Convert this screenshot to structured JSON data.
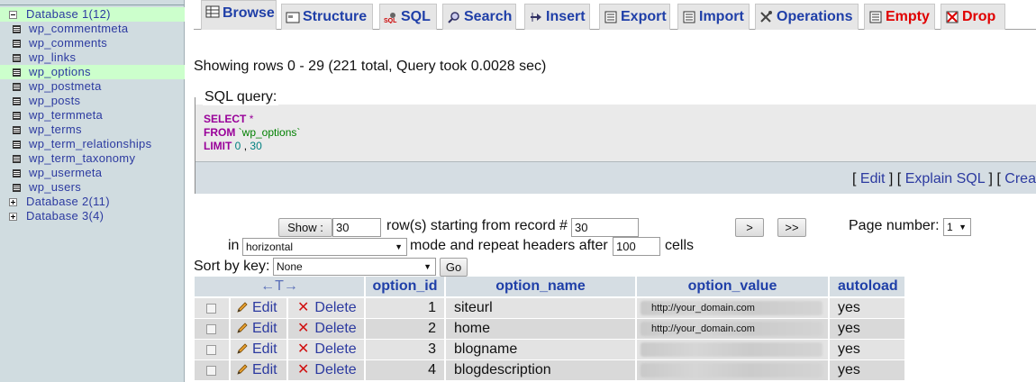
{
  "sidebar": {
    "databases": [
      {
        "label": "Database 1(12)",
        "expanded": true
      },
      {
        "label": "Database 2(11)",
        "expanded": false
      },
      {
        "label": "Database 3(4)",
        "expanded": false
      }
    ],
    "tables": [
      "wp_commentmeta",
      "wp_comments",
      "wp_links",
      "wp_options",
      "wp_postmeta",
      "wp_posts",
      "wp_termmeta",
      "wp_terms",
      "wp_term_relationships",
      "wp_term_taxonomy",
      "wp_usermeta",
      "wp_users"
    ],
    "selected_table": "wp_options"
  },
  "tabs": [
    {
      "label": "Browse",
      "icon": "browse-icon"
    },
    {
      "label": "Structure",
      "icon": "structure-icon"
    },
    {
      "label": "SQL",
      "icon": "sql-icon"
    },
    {
      "label": "Search",
      "icon": "search-icon"
    },
    {
      "label": "Insert",
      "icon": "insert-icon"
    },
    {
      "label": "Export",
      "icon": "export-icon"
    },
    {
      "label": "Import",
      "icon": "import-icon"
    },
    {
      "label": "Operations",
      "icon": "operations-icon"
    },
    {
      "label": "Empty",
      "icon": "empty-icon"
    },
    {
      "label": "Drop",
      "icon": "drop-icon"
    }
  ],
  "status": "Showing rows 0 - 29 (221 total, Query took 0.0028 sec)",
  "sql_query": {
    "legend": "SQL query:",
    "select_kw": "SELECT",
    "select_rest": "*",
    "from_kw": "FROM",
    "from_table": "`wp_options`",
    "limit_kw": "LIMIT",
    "limit_a": "0",
    "limit_sep": ",",
    "limit_b": "30",
    "links": {
      "open": "[ ",
      "edit": "Edit",
      "mid": " ] [ ",
      "explain": "Explain SQL",
      "mid2": " ] [ ",
      "create": "Crea"
    }
  },
  "navigation": {
    "show_button": "Show :",
    "rows_value": "30",
    "rows_text": "row(s) starting from record #",
    "start_value": "30",
    "next_button": ">",
    "last_button": ">>",
    "page_number_label": "Page number:",
    "page_number_value": "1",
    "in_label": "in",
    "mode_value": "horizontal",
    "mode_text": "mode and repeat headers after",
    "headers_value": "100",
    "cells_text": "cells",
    "sort_label": "Sort by key:",
    "sort_value": "None",
    "go_button": "Go"
  },
  "table": {
    "sort_arrows": "←T→",
    "columns": [
      "option_id",
      "option_name",
      "option_value",
      "autoload"
    ],
    "edit_label": "Edit",
    "delete_label": "Delete",
    "rows": [
      {
        "option_id": "1",
        "option_name": "siteurl",
        "option_value": "http://your_domain.com",
        "autoload": "yes"
      },
      {
        "option_id": "2",
        "option_name": "home",
        "option_value": "http://your_domain.com",
        "autoload": "yes"
      },
      {
        "option_id": "3",
        "option_name": "blogname",
        "option_value": "",
        "autoload": "yes"
      },
      {
        "option_id": "4",
        "option_name": "blogdescription",
        "option_value": "",
        "autoload": "yes"
      }
    ]
  }
}
